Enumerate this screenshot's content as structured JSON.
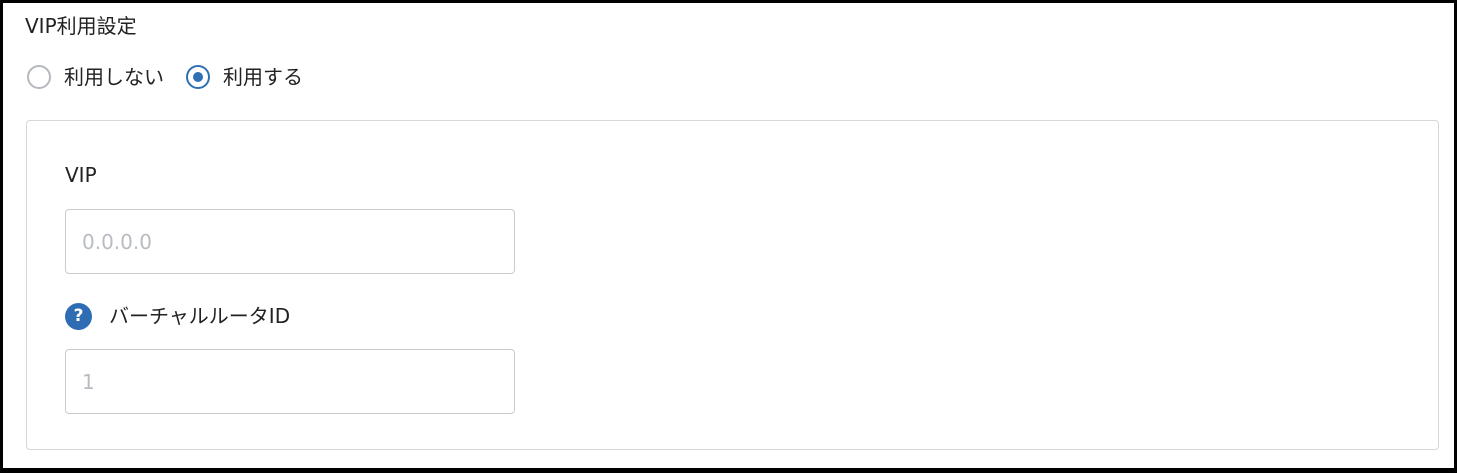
{
  "section": {
    "title": "VIP利用設定"
  },
  "radio": {
    "options": [
      {
        "label": "利用しない",
        "checked": false
      },
      {
        "label": "利用する",
        "checked": true
      }
    ]
  },
  "fields": {
    "vip": {
      "label": "VIP",
      "value": "",
      "placeholder": "0.0.0.0"
    },
    "router_id": {
      "label": "バーチャルルータID",
      "value": "",
      "placeholder": "1",
      "help_icon": "question-circle-icon",
      "help_glyph": "?"
    }
  },
  "colors": {
    "accent": "#2f6fb4",
    "help_icon": "#2e6db3",
    "border": "#c8ccd1",
    "placeholder": "#b8bcc2"
  }
}
